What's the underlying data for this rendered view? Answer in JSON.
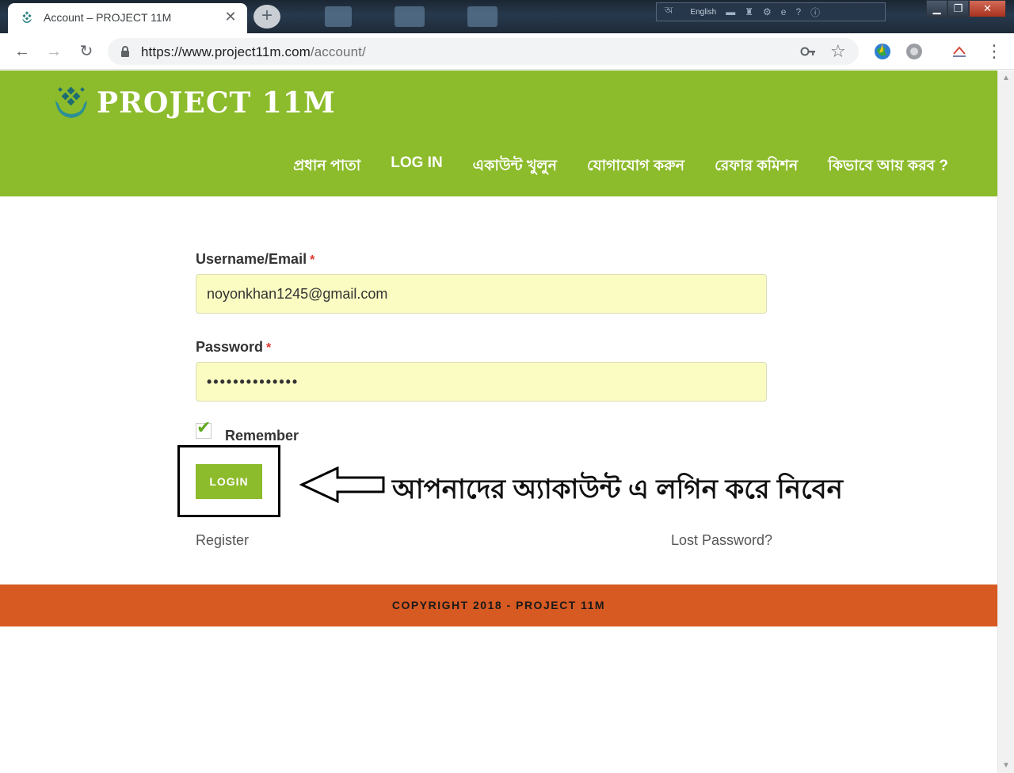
{
  "browser": {
    "tab_title": "Account – PROJECT 11M",
    "tab_close": "✕",
    "new_tab": "+",
    "tray_lang": "English",
    "url_host": "https://www.project11m.com",
    "url_path": "/account/"
  },
  "site": {
    "logo_text": "PROJECT 11M",
    "nav": [
      "প্রধান পাতা",
      "LOG IN",
      "একাউন্ট খুলুন",
      "যোগাযোগ করুন",
      "রেফার কমিশন",
      "কিভাবে আয় করব ?"
    ],
    "brand_color": "#8cbb2b",
    "footer_color": "#d75a22"
  },
  "form": {
    "username_label": "Username/Email",
    "username_value": "noyonkhan1245@gmail.com",
    "password_label": "Password",
    "password_value": "••••••••••••••",
    "required_mark": "*",
    "remember_label": "Remember",
    "remember_checked": true,
    "login_button": "LOGIN",
    "register_link": "Register",
    "lost_password_link": "Lost Password?"
  },
  "annotation": {
    "text": "আপনাদের অ্যাকাউন্ট এ লগিন করে নিবেন"
  },
  "footer": {
    "copyright": "COPYRIGHT 2018 - PROJECT 11M"
  }
}
